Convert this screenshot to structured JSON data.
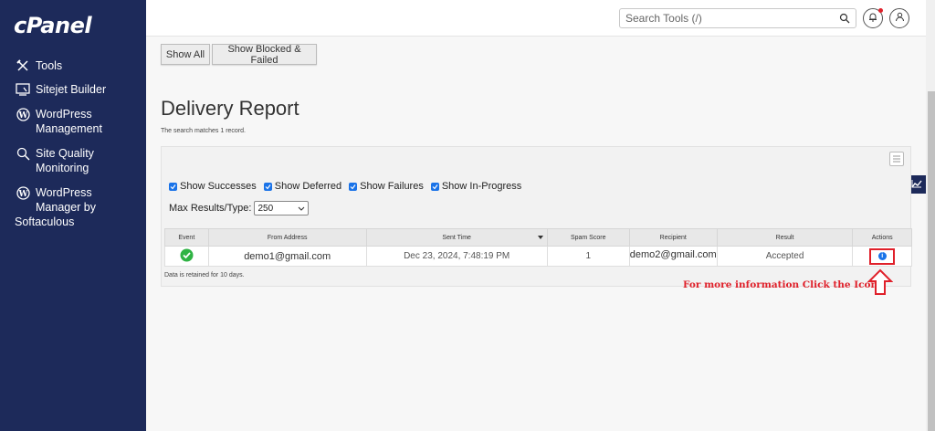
{
  "sidebar": {
    "logo": "cPanel",
    "items": [
      {
        "label": "Tools",
        "icon": "tools-icon"
      },
      {
        "label": "Sitejet Builder",
        "icon": "sitejet-icon"
      },
      {
        "label": "WordPress\nManagement",
        "icon": "wordpress-icon"
      },
      {
        "label": "Site Quality\nMonitoring",
        "icon": "site-quality-icon"
      },
      {
        "label": "WordPress\nManager by",
        "icon": "wordpress-icon"
      }
    ],
    "extra_line": "Softaculous"
  },
  "header": {
    "search_placeholder": "Search Tools (/)"
  },
  "buttons": {
    "show_all": "Show All",
    "show_blocked": "Show Blocked & Failed"
  },
  "main": {
    "title": "Delivery Report",
    "subtitle": "The search matches 1 record.",
    "filters": [
      "Show Successes",
      "Show Deferred",
      "Show Failures",
      "Show In-Progress"
    ],
    "max_results_label": "Max Results/Type:",
    "max_results_value": "250",
    "columns": [
      "Event",
      "From Address",
      "Sent Time",
      "Spam Score",
      "Recipient",
      "Result",
      "Actions"
    ],
    "rows": [
      {
        "from": "demo1@gmail.com",
        "sent": "Dec 23, 2024, 7:48:19 PM",
        "spam": "1",
        "recipient": "demo2@gmail.com",
        "result": "Accepted"
      }
    ],
    "retention_note": "Data is retained for 10 days."
  },
  "annotation": "For more information Click the Icon",
  "colors": {
    "sidebar": "#1d2a5a",
    "accent": "#1a73e8",
    "success": "#2fb344",
    "annotation": "#e0202a"
  }
}
